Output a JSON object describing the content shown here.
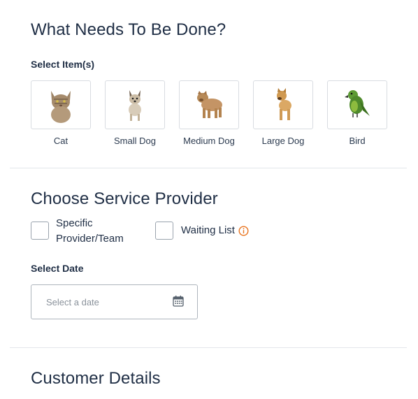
{
  "sections": {
    "what_needed": "What Needs To Be Done?",
    "provider": "Choose Service Provider",
    "customer": "Customer Details"
  },
  "select_items": {
    "label": "Select Item(s)",
    "items": [
      {
        "label": "Cat",
        "icon": "cat-icon"
      },
      {
        "label": "Small Dog",
        "icon": "small-dog-icon"
      },
      {
        "label": "Medium Dog",
        "icon": "medium-dog-icon"
      },
      {
        "label": "Large Dog",
        "icon": "large-dog-icon"
      },
      {
        "label": "Bird",
        "icon": "bird-icon"
      }
    ]
  },
  "provider_options": {
    "specific_line1": "Specific",
    "specific_line2": "Provider/Team",
    "waiting_list": "Waiting List",
    "info_icon": "info-icon"
  },
  "date": {
    "label": "Select Date",
    "placeholder": "Select a date",
    "icon": "calendar-icon"
  },
  "colors": {
    "heading": "#1f2e45",
    "info_accent": "#e8731e",
    "border": "#d8dce1"
  }
}
